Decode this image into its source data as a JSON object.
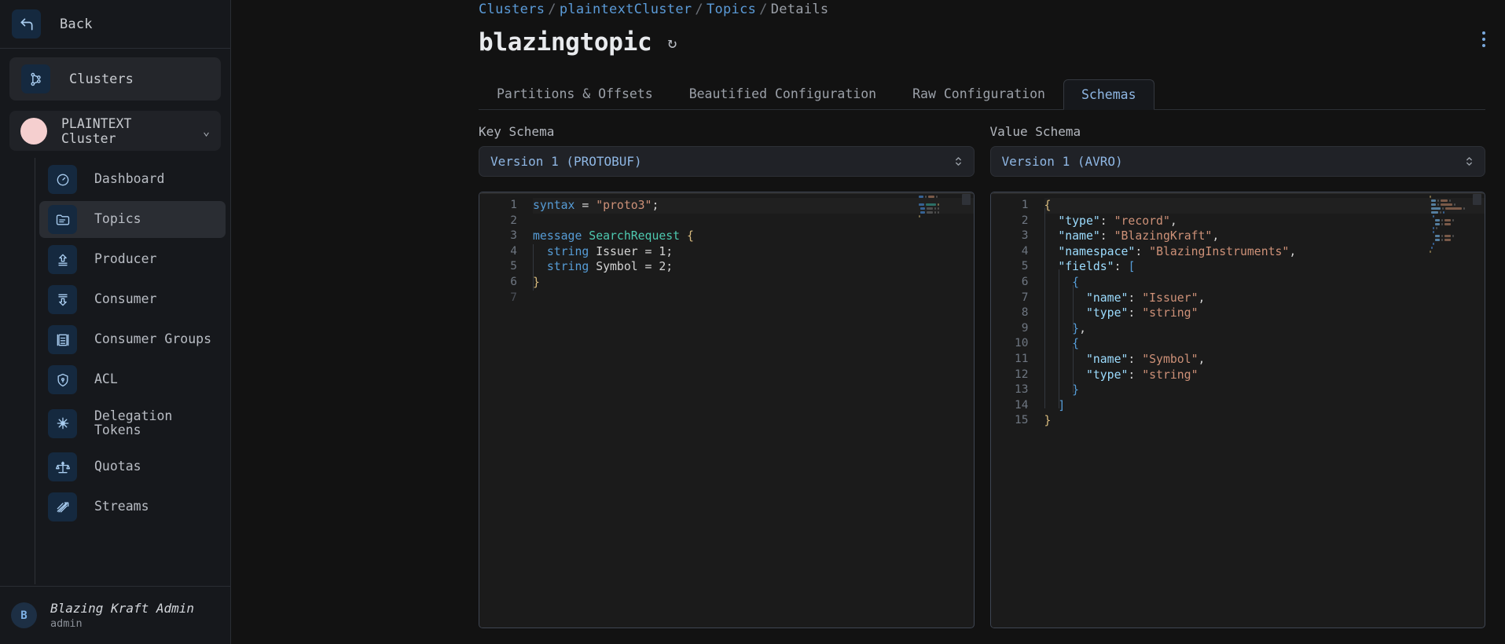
{
  "sidebar": {
    "back_label": "Back",
    "clusters_label": "Clusters",
    "cluster_name": "PLAINTEXT Cluster",
    "chevron": "⌄",
    "nav_items": [
      {
        "label": "Dashboard",
        "icon": "gauge-icon",
        "active": false
      },
      {
        "label": "Topics",
        "icon": "folder-icon",
        "active": true
      },
      {
        "label": "Producer",
        "icon": "upload-icon",
        "active": false
      },
      {
        "label": "Consumer",
        "icon": "download-icon",
        "active": false
      },
      {
        "label": "Consumer Groups",
        "icon": "group-icon",
        "active": false
      },
      {
        "label": "ACL",
        "icon": "shield-lock-icon",
        "active": false
      },
      {
        "label": "Delegation Tokens",
        "icon": "asterisk-icon",
        "active": false
      },
      {
        "label": "Quotas",
        "icon": "scales-icon",
        "active": false
      },
      {
        "label": "Streams",
        "icon": "streams-icon",
        "active": false
      }
    ],
    "user": {
      "initial": "B",
      "name": "Blazing Kraft Admin",
      "role": "admin"
    }
  },
  "header": {
    "breadcrumb": [
      {
        "text": "Clusters",
        "link": true
      },
      {
        "text": "plaintextCluster",
        "link": true
      },
      {
        "text": "Topics",
        "link": true
      },
      {
        "text": "Details",
        "link": false
      }
    ],
    "separator": "/",
    "title": "blazingtopic",
    "refresh_glyph": "↻",
    "menu_icon": "kebab-menu-icon"
  },
  "tabs": [
    {
      "label": "Partitions & Offsets",
      "active": false
    },
    {
      "label": "Beautified Configuration",
      "active": false
    },
    {
      "label": "Raw Configuration",
      "active": false
    },
    {
      "label": "Schemas",
      "active": true
    }
  ],
  "key_schema": {
    "label": "Key Schema",
    "version_value": "Version 1 (PROTOBUF)",
    "line_count": 7,
    "lines": [
      {
        "n": 1,
        "tokens": [
          {
            "t": "syntax ",
            "c": "t-key"
          },
          {
            "t": "= ",
            "c": "t-plain"
          },
          {
            "t": "\"proto3\"",
            "c": "t-str"
          },
          {
            "t": ";",
            "c": "t-plain"
          }
        ]
      },
      {
        "n": 2,
        "tokens": []
      },
      {
        "n": 3,
        "tokens": [
          {
            "t": "message ",
            "c": "t-key"
          },
          {
            "t": "SearchRequest ",
            "c": "t-type"
          },
          {
            "t": "{",
            "c": "t-brace"
          }
        ]
      },
      {
        "n": 4,
        "tokens": [
          {
            "t": "  ",
            "c": "t-plain"
          },
          {
            "t": "string ",
            "c": "t-key"
          },
          {
            "t": "Issuer = ",
            "c": "t-plain"
          },
          {
            "t": "1",
            "c": "t-plain"
          },
          {
            "t": ";",
            "c": "t-plain"
          }
        ]
      },
      {
        "n": 5,
        "tokens": [
          {
            "t": "  ",
            "c": "t-plain"
          },
          {
            "t": "string ",
            "c": "t-key"
          },
          {
            "t": "Symbol = ",
            "c": "t-plain"
          },
          {
            "t": "2",
            "c": "t-plain"
          },
          {
            "t": ";",
            "c": "t-plain"
          }
        ]
      },
      {
        "n": 6,
        "tokens": [
          {
            "t": "}",
            "c": "t-brace"
          }
        ]
      },
      {
        "n": 7,
        "tokens": []
      }
    ]
  },
  "value_schema": {
    "label": "Value Schema",
    "version_value": "Version 1 (AVRO)",
    "line_count": 15,
    "lines": [
      {
        "n": 1,
        "tokens": [
          {
            "t": "{",
            "c": "t-brace"
          }
        ]
      },
      {
        "n": 2,
        "tokens": [
          {
            "t": "  ",
            "c": "t-plain"
          },
          {
            "t": "\"type\"",
            "c": "t-prop"
          },
          {
            "t": ": ",
            "c": "t-punct"
          },
          {
            "t": "\"record\"",
            "c": "t-str"
          },
          {
            "t": ",",
            "c": "t-punct"
          }
        ]
      },
      {
        "n": 3,
        "tokens": [
          {
            "t": "  ",
            "c": "t-plain"
          },
          {
            "t": "\"name\"",
            "c": "t-prop"
          },
          {
            "t": ": ",
            "c": "t-punct"
          },
          {
            "t": "\"BlazingKraft\"",
            "c": "t-str"
          },
          {
            "t": ",",
            "c": "t-punct"
          }
        ]
      },
      {
        "n": 4,
        "tokens": [
          {
            "t": "  ",
            "c": "t-plain"
          },
          {
            "t": "\"namespace\"",
            "c": "t-prop"
          },
          {
            "t": ": ",
            "c": "t-punct"
          },
          {
            "t": "\"BlazingInstruments\"",
            "c": "t-str"
          },
          {
            "t": ",",
            "c": "t-punct"
          }
        ]
      },
      {
        "n": 5,
        "tokens": [
          {
            "t": "  ",
            "c": "t-plain"
          },
          {
            "t": "\"fields\"",
            "c": "t-prop"
          },
          {
            "t": ": ",
            "c": "t-punct"
          },
          {
            "t": "[",
            "c": "t-brace2"
          }
        ]
      },
      {
        "n": 6,
        "tokens": [
          {
            "t": "    ",
            "c": "t-plain"
          },
          {
            "t": "{",
            "c": "t-brace2"
          }
        ]
      },
      {
        "n": 7,
        "tokens": [
          {
            "t": "      ",
            "c": "t-plain"
          },
          {
            "t": "\"name\"",
            "c": "t-prop"
          },
          {
            "t": ": ",
            "c": "t-punct"
          },
          {
            "t": "\"Issuer\"",
            "c": "t-str"
          },
          {
            "t": ",",
            "c": "t-punct"
          }
        ]
      },
      {
        "n": 8,
        "tokens": [
          {
            "t": "      ",
            "c": "t-plain"
          },
          {
            "t": "\"type\"",
            "c": "t-prop"
          },
          {
            "t": ": ",
            "c": "t-punct"
          },
          {
            "t": "\"string\"",
            "c": "t-str"
          }
        ]
      },
      {
        "n": 9,
        "tokens": [
          {
            "t": "    ",
            "c": "t-plain"
          },
          {
            "t": "}",
            "c": "t-brace2"
          },
          {
            "t": ",",
            "c": "t-punct"
          }
        ]
      },
      {
        "n": 10,
        "tokens": [
          {
            "t": "    ",
            "c": "t-plain"
          },
          {
            "t": "{",
            "c": "t-brace2"
          }
        ]
      },
      {
        "n": 11,
        "tokens": [
          {
            "t": "      ",
            "c": "t-plain"
          },
          {
            "t": "\"name\"",
            "c": "t-prop"
          },
          {
            "t": ": ",
            "c": "t-punct"
          },
          {
            "t": "\"Symbol\"",
            "c": "t-str"
          },
          {
            "t": ",",
            "c": "t-punct"
          }
        ]
      },
      {
        "n": 12,
        "tokens": [
          {
            "t": "      ",
            "c": "t-plain"
          },
          {
            "t": "\"type\"",
            "c": "t-prop"
          },
          {
            "t": ": ",
            "c": "t-punct"
          },
          {
            "t": "\"string\"",
            "c": "t-str"
          }
        ]
      },
      {
        "n": 13,
        "tokens": [
          {
            "t": "    ",
            "c": "t-plain"
          },
          {
            "t": "}",
            "c": "t-brace2"
          }
        ]
      },
      {
        "n": 14,
        "tokens": [
          {
            "t": "  ",
            "c": "t-plain"
          },
          {
            "t": "]",
            "c": "t-brace2"
          }
        ]
      },
      {
        "n": 15,
        "tokens": [
          {
            "t": "}",
            "c": "t-brace"
          }
        ]
      }
    ]
  },
  "colors": {
    "page_bg": "#121212",
    "sidebar_bg": "#16181c",
    "accent_link": "#5b9bd8",
    "tab_active": "#8fb7e4",
    "editor_bg": "#1b1b1b",
    "editor_border": "#3f4653",
    "cluster_dot": "#f5cfcf"
  }
}
